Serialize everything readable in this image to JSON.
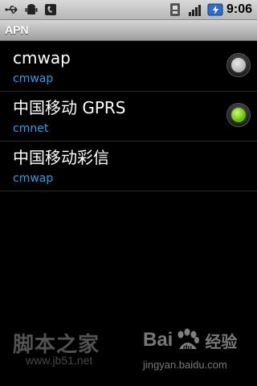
{
  "status_bar": {
    "time": "9:06",
    "icons": [
      "usb-icon",
      "android-debug-icon",
      "phone-icon",
      "sim-icon",
      "signal-icon",
      "battery-charging-icon"
    ]
  },
  "title_bar": {
    "title": "APN"
  },
  "apn_list": [
    {
      "name": "cmwap",
      "apn": "cmwap",
      "selected": false,
      "has_radio": true
    },
    {
      "name": "中国移动 GPRS",
      "apn": "cmnet",
      "selected": true,
      "has_radio": true
    },
    {
      "name": "中国移动彩信",
      "apn": "cmwap",
      "selected": false,
      "has_radio": false
    }
  ],
  "watermarks": {
    "left_text": "脚本之家",
    "left_url": "www.jb51.net",
    "right_brand": "Bai",
    "right_brand_suffix": "du",
    "right_service": "经验",
    "right_url": "jingyan.baidu.com"
  },
  "colors": {
    "sub_text": "#2f9ee8",
    "radio_on": "#6bd000",
    "radio_off": "#bdbdbd",
    "background": "#000000"
  }
}
